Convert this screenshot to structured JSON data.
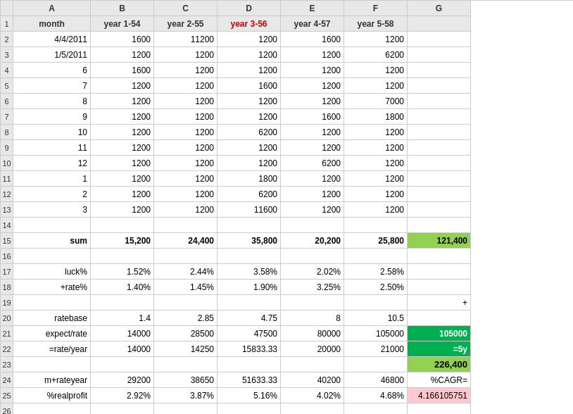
{
  "columns": {
    "row_num": "",
    "A": "A",
    "B": "B",
    "C": "C",
    "D": "D",
    "E": "E",
    "F": "F",
    "G": "G"
  },
  "header": {
    "row": "1",
    "A": "month",
    "B": "year 1-54",
    "C": "year 2-55",
    "D": "year 3-56",
    "E": "year 4-57",
    "F": "year 5-58",
    "G": ""
  },
  "rows": [
    {
      "num": "2",
      "A": "4/4/2011",
      "B": "1600",
      "C": "11200",
      "D": "1200",
      "E": "1600",
      "F": "1200",
      "G": ""
    },
    {
      "num": "3",
      "A": "1/5/2011",
      "B": "1200",
      "C": "1200",
      "D": "1200",
      "E": "1200",
      "F": "6200",
      "G": ""
    },
    {
      "num": "4",
      "A": "6",
      "B": "1600",
      "C": "1200",
      "D": "1200",
      "E": "1200",
      "F": "1200",
      "G": ""
    },
    {
      "num": "5",
      "A": "7",
      "B": "1200",
      "C": "1200",
      "D": "1600",
      "E": "1200",
      "F": "1200",
      "G": ""
    },
    {
      "num": "6",
      "A": "8",
      "B": "1200",
      "C": "1200",
      "D": "1200",
      "E": "1200",
      "F": "7000",
      "G": ""
    },
    {
      "num": "7",
      "A": "9",
      "B": "1200",
      "C": "1200",
      "D": "1200",
      "E": "1600",
      "F": "1800",
      "G": ""
    },
    {
      "num": "8",
      "A": "10",
      "B": "1200",
      "C": "1200",
      "D": "6200",
      "E": "1200",
      "F": "1200",
      "G": ""
    },
    {
      "num": "9",
      "A": "11",
      "B": "1200",
      "C": "1200",
      "D": "1200",
      "E": "1200",
      "F": "1200",
      "G": ""
    },
    {
      "num": "10",
      "A": "12",
      "B": "1200",
      "C": "1200",
      "D": "1200",
      "E": "6200",
      "F": "1200",
      "G": ""
    },
    {
      "num": "11",
      "A": "1",
      "B": "1200",
      "C": "1200",
      "D": "1800",
      "E": "1200",
      "F": "1200",
      "G": ""
    },
    {
      "num": "12",
      "A": "2",
      "B": "1200",
      "C": "1200",
      "D": "6200",
      "E": "1200",
      "F": "1200",
      "G": ""
    },
    {
      "num": "13",
      "A": "3",
      "B": "1200",
      "C": "1200",
      "D": "11600",
      "E": "1200",
      "F": "1200",
      "G": ""
    },
    {
      "num": "14",
      "A": "",
      "B": "",
      "C": "",
      "D": "",
      "E": "",
      "F": "",
      "G": ""
    },
    {
      "num": "15",
      "A": "sum",
      "B": "15,200",
      "C": "24,400",
      "D": "35,800",
      "E": "20,200",
      "F": "25,800",
      "G": "121,400",
      "G_style": "green-bg"
    },
    {
      "num": "16",
      "A": "",
      "B": "",
      "C": "",
      "D": "",
      "E": "",
      "F": "",
      "G": ""
    },
    {
      "num": "17",
      "A": "luck%",
      "B": "1.52%",
      "C": "2.44%",
      "D": "3.58%",
      "E": "2.02%",
      "F": "2.58%",
      "G": ""
    },
    {
      "num": "18",
      "A": "+rate%",
      "B": "1.40%",
      "C": "1.45%",
      "D": "1.90%",
      "E": "3.25%",
      "F": "2.50%",
      "G": ""
    },
    {
      "num": "19",
      "A": "",
      "B": "",
      "C": "",
      "D": "",
      "E": "",
      "F": "",
      "G": "+"
    },
    {
      "num": "20",
      "A": "ratebase",
      "B": "1.4",
      "C": "2.85",
      "D": "4.75",
      "E": "8",
      "F": "10.5",
      "G": ""
    },
    {
      "num": "21",
      "A": "expect/rate",
      "B": "14000",
      "C": "28500",
      "D": "47500",
      "E": "80000",
      "F": "105000",
      "G": "105000",
      "G_style": "dark-green-bg"
    },
    {
      "num": "22",
      "A": "=rate/year",
      "B": "14000",
      "C": "14250",
      "D": "15833.33",
      "E": "20000",
      "F": "21000",
      "G": "=5y",
      "G_style": "dark-green-bg"
    },
    {
      "num": "23",
      "A": "",
      "B": "",
      "C": "",
      "D": "",
      "E": "",
      "F": "",
      "G": "226,400",
      "G_style": "green-bg"
    },
    {
      "num": "24",
      "A": "m+rateyear",
      "B": "29200",
      "C": "38650",
      "D": "51633.33",
      "E": "40200",
      "F": "46800",
      "G": "%CAGR=",
      "G_style": ""
    },
    {
      "num": "25",
      "A": "%realprofit",
      "B": "2.92%",
      "C": "3.87%",
      "D": "5.16%",
      "E": "4.02%",
      "F": "4.68%",
      "G": "4.166105751",
      "G_style": "light-red-bg"
    },
    {
      "num": "26",
      "A": "",
      "B": "",
      "C": "",
      "D": "",
      "E": "",
      "F": "",
      "G": ""
    }
  ]
}
